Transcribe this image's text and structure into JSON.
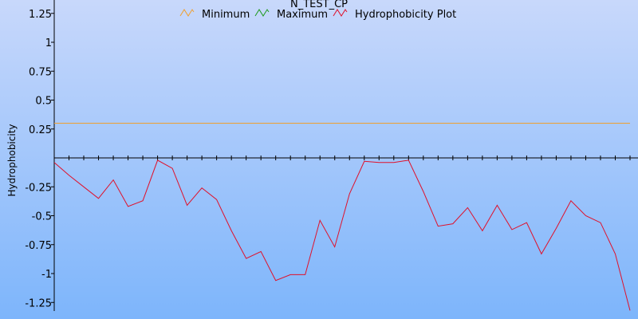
{
  "chart_data": {
    "type": "line",
    "title": "N_TEST_CP",
    "ylabel": "Hydrophobicity",
    "xlabel": "",
    "ylim": [
      -1.3,
      1.3
    ],
    "yticks": [
      1.25,
      1,
      0.75,
      0.5,
      0.25,
      -0.25,
      -0.5,
      -0.75,
      -1,
      -1.25
    ],
    "ytick_labels": [
      "1.25",
      "1",
      "0.75",
      "0.5",
      "0.25",
      "-0.25",
      "-0.5",
      "-0.75",
      "-1",
      "-1.25"
    ],
    "xlim": [
      1,
      40
    ],
    "grid": false,
    "legend_position": "top",
    "background_gradient": [
      "#c8d8fb",
      "#7db5fb"
    ],
    "series": [
      {
        "name": "Minimum",
        "color": "#f0a030",
        "x": [],
        "values": []
      },
      {
        "name": "Maximum",
        "color": "#1e9a1e",
        "x": [],
        "values": []
      },
      {
        "name": "Hydrophobicity Plot",
        "color": "#e0102a",
        "x": [
          1,
          2,
          3,
          4,
          5,
          6,
          7,
          8,
          9,
          10,
          11,
          12,
          13,
          14,
          15,
          16,
          17,
          18,
          19,
          20,
          21,
          22,
          23,
          24,
          25,
          26,
          27,
          28,
          29,
          30,
          31,
          32,
          33,
          34,
          35,
          36,
          37,
          38,
          39,
          40
        ],
        "values": [
          -0.04,
          -0.15,
          -0.25,
          -0.35,
          -0.19,
          -0.42,
          -0.37,
          -0.02,
          -0.09,
          -0.41,
          -0.26,
          -0.36,
          -0.63,
          -0.87,
          -0.81,
          -1.06,
          -1.01,
          -1.01,
          -0.54,
          -0.77,
          -0.31,
          -0.03,
          -0.04,
          -0.04,
          -0.02,
          -0.29,
          -0.59,
          -0.57,
          -0.43,
          -0.63,
          -0.41,
          -0.62,
          -0.56,
          -0.83,
          -0.61,
          -0.37,
          -0.5,
          -0.56,
          -0.83,
          -1.32
        ]
      }
    ],
    "reference_lines": [
      {
        "value": 0.3,
        "color": "#f0a030"
      }
    ]
  }
}
